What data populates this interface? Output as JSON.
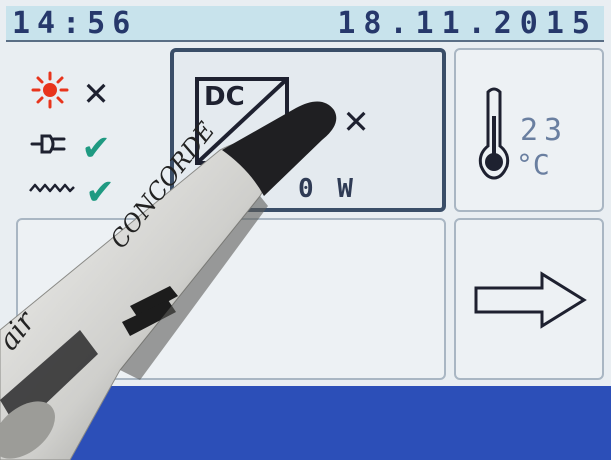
{
  "status_bar": {
    "time": "14:56",
    "date": "18.11.2015"
  },
  "source_status": [
    {
      "icon": "sun-icon",
      "state": "x-mark"
    },
    {
      "icon": "plug-icon",
      "state": "check-mark"
    },
    {
      "icon": "wave-icon",
      "state": "check-mark"
    }
  ],
  "symbols": {
    "x": "✕",
    "check": "✔"
  },
  "inverter": {
    "label": "DC",
    "status": "x-mark",
    "power": "0 W"
  },
  "temperature": {
    "value": "23",
    "unit": "°C"
  },
  "next": {
    "icon": "arrow-right-icon"
  },
  "pen": {
    "brand": "CONCORDE",
    "text_left": "air"
  },
  "colors": {
    "accent": "#2c4fb8",
    "check": "#1f9a82",
    "sun": "#e8341c"
  }
}
